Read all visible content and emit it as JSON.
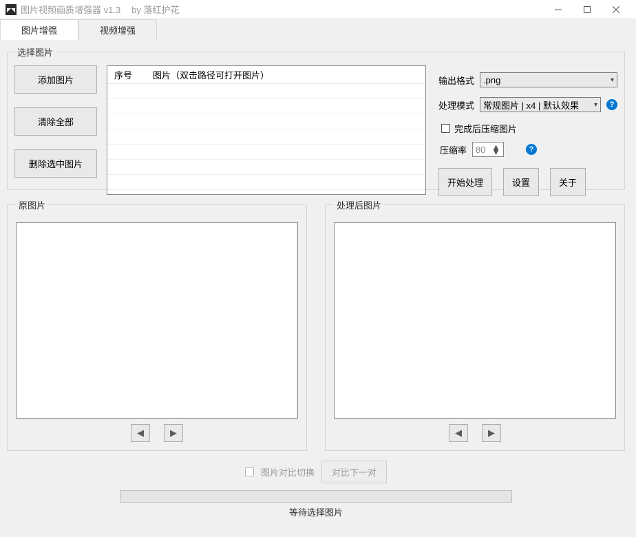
{
  "titlebar": {
    "title": "图片视频画质增强器 v1.3",
    "author": "by 落红护花"
  },
  "tabs": {
    "image": "图片增强",
    "video": "视频增强"
  },
  "select_group": {
    "legend": "选择图片",
    "add": "添加图片",
    "clear": "清除全部",
    "delete": "删除选中图片",
    "table": {
      "col_index": "序号",
      "col_image": "图片（双击路径可打开图片）"
    }
  },
  "settings": {
    "output_format_label": "输出格式",
    "output_format_value": ".png",
    "process_mode_label": "处理模式",
    "process_mode_value": "常规图片 | x4 | 默认效果",
    "compress_after": "完成后压缩图片",
    "compress_rate_label": "压缩率",
    "compress_rate_value": "80",
    "help": "?"
  },
  "actions": {
    "start": "开始处理",
    "settings_btn": "设置",
    "about": "关于"
  },
  "preview": {
    "original": "原图片",
    "processed": "处理后图片"
  },
  "compare": {
    "toggle_label": "图片对比切换",
    "next_pair": "对比下一对"
  },
  "status": "等待选择图片"
}
